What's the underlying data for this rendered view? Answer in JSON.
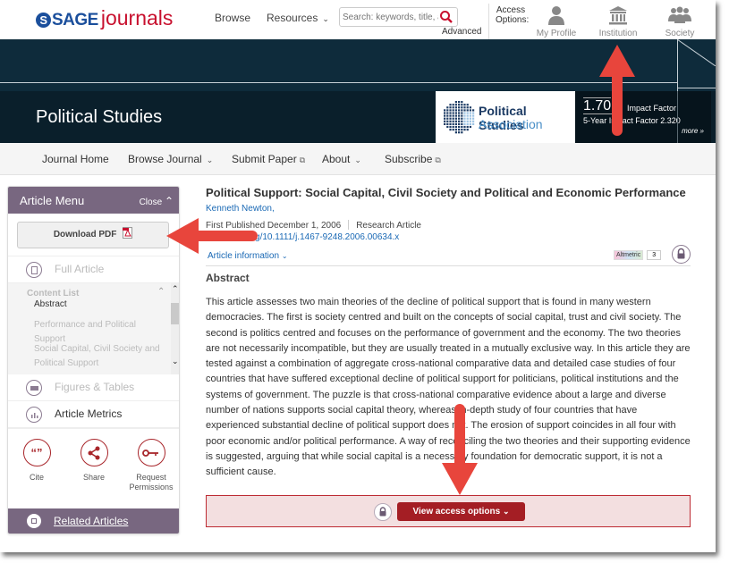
{
  "header": {
    "logo_brand": "SAGE",
    "logo_product": "journals",
    "nav": [
      {
        "label": "Browse"
      },
      {
        "label": "Resources",
        "dropdown": true
      }
    ],
    "search": {
      "placeholder": "Search: keywords, title, author",
      "value": ""
    },
    "advanced_label": "Advanced",
    "access_options_label": "Access Options:",
    "access_options": [
      {
        "label": "My Profile",
        "icon": "person-icon"
      },
      {
        "label": "Institution",
        "icon": "institution-icon"
      },
      {
        "label": "Society",
        "icon": "group-icon"
      }
    ]
  },
  "banner": {
    "journal_title": "Political Studies",
    "society_name_line1": "Political Studies",
    "society_name_line2": "Association",
    "impact_factor_value": "1.70",
    "impact_factor_label": "Impact Factor",
    "five_year_label": "5-Year Impact Factor 2.320",
    "more_label": "more »"
  },
  "journal_nav": [
    {
      "label": "Journal Home"
    },
    {
      "label": "Browse Journal",
      "dropdown": true
    },
    {
      "label": "Submit Paper",
      "external": true
    },
    {
      "label": "About",
      "dropdown": true
    },
    {
      "label": "Subscribe",
      "external": true
    }
  ],
  "article_menu": {
    "title": "Article Menu",
    "close_label": "Close",
    "download_pdf_label": "Download PDF",
    "full_article_label": "Full Article",
    "content_list_label": "Content List",
    "content_items": [
      {
        "label": "Abstract",
        "active": true
      },
      {
        "label": "Performance and Political Support",
        "active": false
      },
      {
        "label": "Social Capital, Civil Society and Political Support",
        "active": false
      }
    ],
    "figures_label": "Figures & Tables",
    "metrics_label": "Article Metrics",
    "tools": [
      {
        "label": "Cite",
        "icon": "quote-icon"
      },
      {
        "label": "Share",
        "icon": "share-icon"
      },
      {
        "label": "Request Permissions",
        "icon": "key-icon"
      }
    ],
    "related_label": "Related Articles"
  },
  "article": {
    "title": "Political Support: Social Capital, Civil Society and Political and Economic Performance",
    "author": "Kenneth Newton,",
    "first_published": "First Published December 1, 2006",
    "article_type": "Research Article",
    "doi": "https://doi.org/10.1111/j.1467-9248.2006.00634.x",
    "doi_visible": "11/j.1467-9248.2006.00634.x",
    "article_info_label": "Article information",
    "altmetric_label": "Altmetric",
    "altmetric_score": "3",
    "abstract_heading": "Abstract",
    "abstract_text": "This article assesses two main theories of the decline of political support that is found in many western democracies. The first is society centred and built on the concepts of social capital, trust and civil society. The second is politics centred and focuses on the performance of government and the economy. The two theories are not necessarily incompatible, but they are usually treated in a mutually exclusive way. In this article they are tested against a combination of aggregate cross-national comparative data and detailed case studies of four countries that have suffered exceptional decline of political support for politicians, political institutions and the systems of government. The puzzle is that cross-national comparative evidence about a large and diverse number of nations supports social capital theory, whereas in-depth study of four countries that have experienced substantial decline of political support does not. The erosion of support coincides in all four with poor economic and/or political performance. A way of reconciling the two theories and their supporting evidence is suggested, arguing that while social capital is a necessary foundation for democratic support, it is not a sufficient cause.",
    "view_access_label": "View access options"
  },
  "colors": {
    "brand_blue": "#1b4f9c",
    "brand_red": "#c8102e",
    "menu_purple": "#786780",
    "access_red": "#a41e24",
    "banner_navy": "#0e2b3b",
    "annotation_arrow": "#e8453c"
  }
}
